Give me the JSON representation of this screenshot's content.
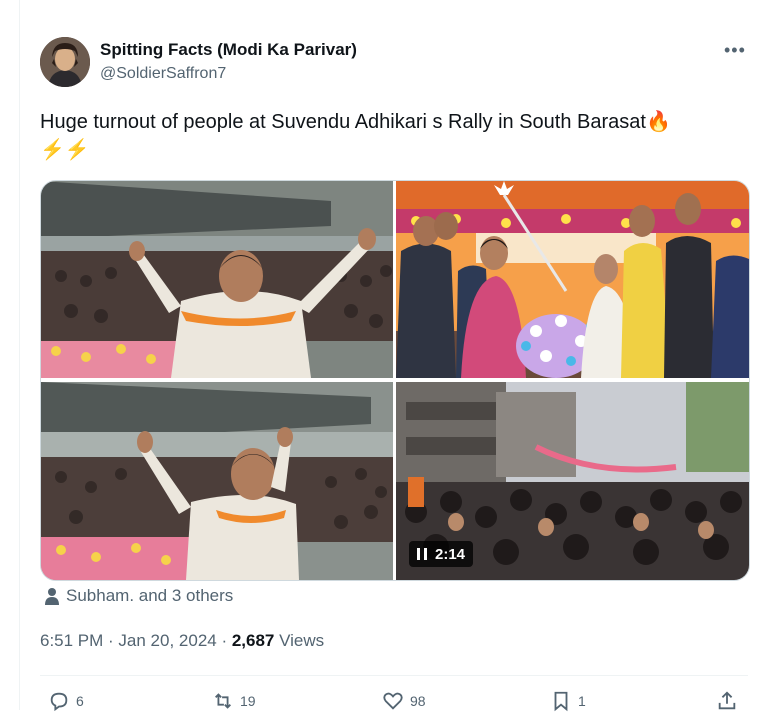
{
  "author": {
    "display_name": "Spitting Facts (Modi Ka Parivar)",
    "handle": "@SoldierSaffron7"
  },
  "tweet": {
    "text": "Huge turnout of people at Suvendu Adhikari s Rally in South Barasat",
    "emoji_line1": "🔥",
    "emoji_line2": "⚡⚡"
  },
  "media": {
    "video_duration": "2:14",
    "tiles": [
      "rally-crowd-waving",
      "stage-ceremony",
      "rally-crowd-waving-2",
      "street-crowd-video"
    ]
  },
  "tagged": {
    "text": "Subham. and 3 others"
  },
  "meta": {
    "time": "6:51 PM",
    "sep1": " · ",
    "date": "Jan 20, 2024",
    "sep2": " · ",
    "views_count": "2,687",
    "views_label": " Views"
  },
  "actions": {
    "replies": "6",
    "retweets": "19",
    "likes": "98",
    "bookmarks": "1"
  },
  "icons": [
    "more-icon",
    "person-icon",
    "reply-icon",
    "retweet-icon",
    "like-icon",
    "bookmark-icon",
    "share-icon",
    "pause-icon"
  ],
  "colors": {
    "text": "#0f1419",
    "secondary": "#536471",
    "border": "#cfd9de"
  }
}
